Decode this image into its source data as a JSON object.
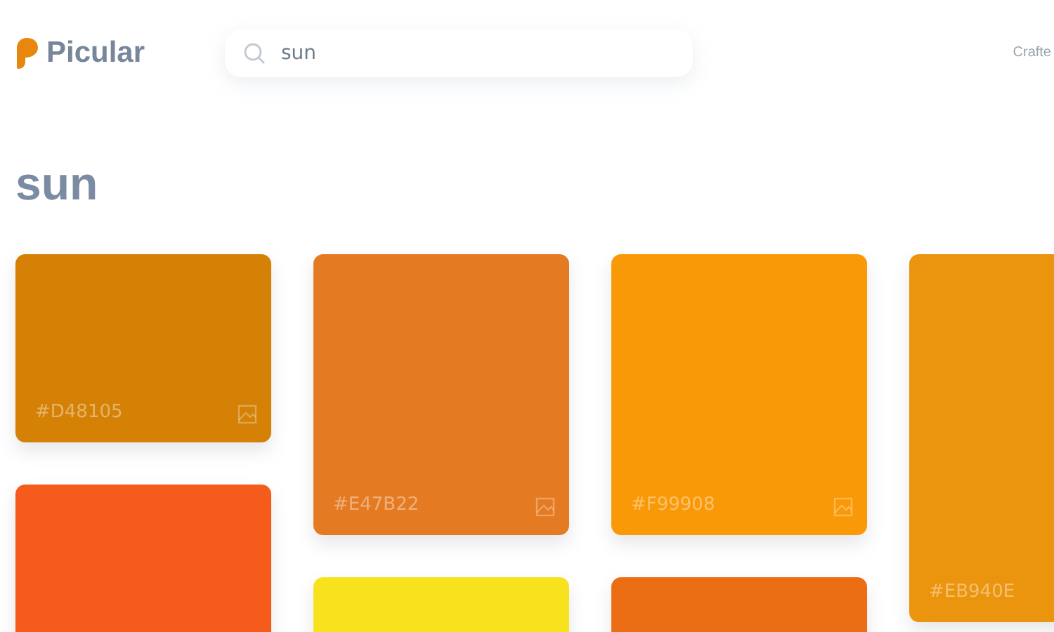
{
  "logo": {
    "text": "Picular"
  },
  "search": {
    "value": "sun"
  },
  "header_link": {
    "text": "Crafte"
  },
  "title": "sun",
  "columns": [
    [
      {
        "color": "#d48105",
        "label": "#D48105"
      },
      {
        "color": "#f55c1c"
      }
    ],
    [
      {
        "color": "#e47b22",
        "label": "#E47B22"
      },
      {
        "color": "#f8e21e"
      }
    ],
    [
      {
        "color": "#f99908",
        "label": "#F99908"
      },
      {
        "color": "#ec6e14"
      }
    ],
    [
      {
        "color": "#eb940e",
        "label": "#EB940E"
      }
    ]
  ]
}
